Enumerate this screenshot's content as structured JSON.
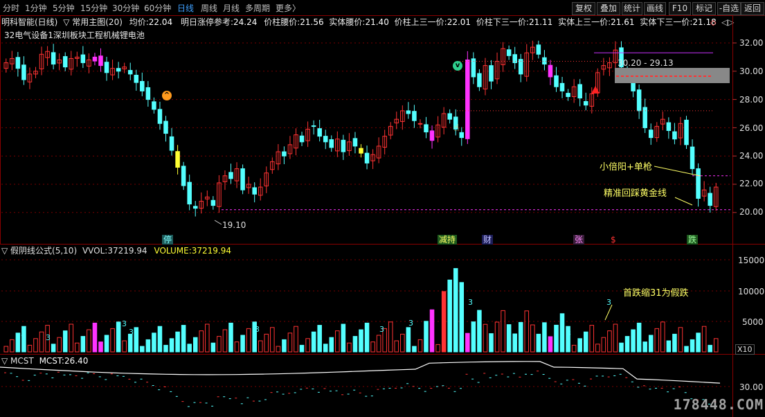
{
  "timeframes": [
    "分时",
    "1分钟",
    "5分钟",
    "15分钟",
    "30分钟",
    "60分钟",
    "日线",
    "周线",
    "月线",
    "多周期",
    "更多〉"
  ],
  "active_timeframe": "日线",
  "toolbar": [
    "复权",
    "叠加",
    "统计",
    "画线",
    "F10",
    "标记",
    "-自选",
    "返回"
  ],
  "info": {
    "stock": "明科智能(日线)",
    "indicator": "▽ 常用主图(20)",
    "items": [
      {
        "l": "均价:",
        "v": "22.04"
      },
      {
        "l": "明日涨停参考:",
        "v": "24.24"
      },
      {
        "l": "价柱腰价:",
        "v": "21.56"
      },
      {
        "l": "实体腰价:",
        "v": "21.40"
      },
      {
        "l": "价柱上三一价:",
        "v": "22.01"
      },
      {
        "l": "价柱下三一价:",
        "v": "21.11"
      },
      {
        "l": "实体上三一价:",
        "v": "21.61"
      },
      {
        "l": "实体下三一价:",
        "v": "21.18"
      }
    ]
  },
  "subtitle": "32电气设备1深圳板块工程机械锂电池",
  "main_axis": [
    "32.00",
    "30.00",
    "28.00",
    "26.00",
    "24.00",
    "22.00",
    "20.00"
  ],
  "annotations": {
    "low": "19.10",
    "range": "30.20 - 29.13",
    "a1": "小倍阳+单枪",
    "a2": "精准回踩黄金线",
    "a3": "首跌缩31为假跌"
  },
  "tags": {
    "t1": "停",
    "t2": "减持",
    "t3": "财",
    "t4": "张",
    "t5": "$",
    "t6": "跌"
  },
  "vol_pane": {
    "title": "▽ 假阴线公式(5,10)",
    "vvol_label": "VVOL:",
    "vvol": "37219.94",
    "volume_label": "VOLUME:",
    "volume": "37219.94",
    "axis": [
      "15000",
      "10000",
      "5000"
    ],
    "unit": "X10"
  },
  "mcst_pane": {
    "title": "▽ MCST",
    "mcst_label": "MCST:",
    "mcst": "26.40",
    "axis": [
      "30.00"
    ]
  },
  "watermark": "178448.COM",
  "colors": {
    "up": "#ff3333",
    "down": "#54ffff",
    "magenta": "#ff33ff",
    "yellow": "#ffff33",
    "grid": "#7a0000"
  }
}
